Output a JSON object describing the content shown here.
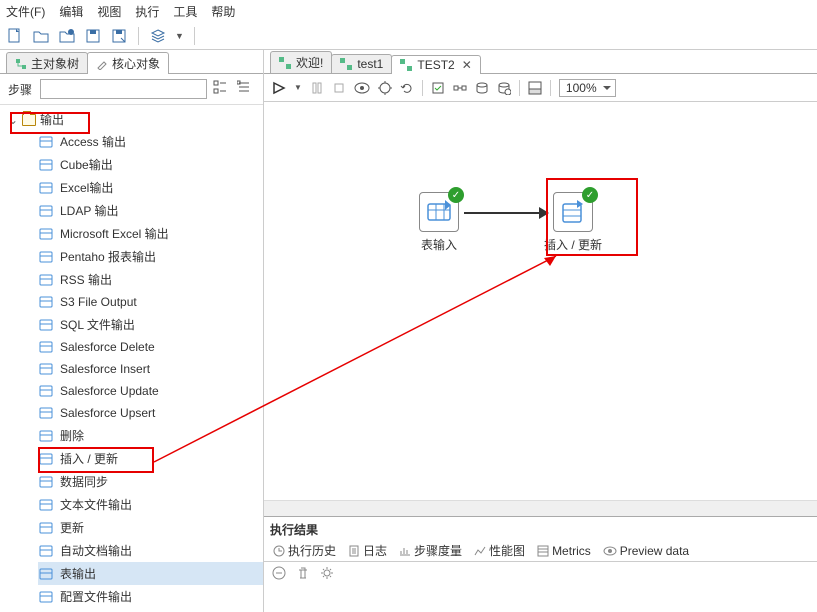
{
  "menu": {
    "file": "文件(F)",
    "edit": "编辑",
    "view": "视图",
    "run": "执行",
    "tools": "工具",
    "help": "帮助"
  },
  "leftTabs": {
    "main": "主对象树",
    "core": "核心对象"
  },
  "search": {
    "label": "步骤"
  },
  "tree": {
    "folder": "输出",
    "items": [
      "Access 输出",
      "Cube输出",
      "Excel输出",
      "LDAP 输出",
      "Microsoft Excel 输出",
      "Pentaho 报表输出",
      "RSS 输出",
      "S3 File Output",
      "SQL 文件输出",
      "Salesforce Delete",
      "Salesforce Insert",
      "Salesforce Update",
      "Salesforce Upsert",
      "删除",
      "插入 / 更新",
      "数据同步",
      "文本文件输出",
      "更新",
      "自动文档输出",
      "表输出",
      "配置文件输出"
    ],
    "selected": "表输出",
    "highlighted": "插入 / 更新"
  },
  "editorTabs": {
    "welcome": "欢迎!",
    "t1": "test1",
    "t2": "TEST2"
  },
  "zoom": "100%",
  "canvas": {
    "node1": "表输入",
    "node2": "插入 / 更新"
  },
  "results": {
    "title": "执行结果",
    "tabs": {
      "hist": "执行历史",
      "log": "日志",
      "metrics": "步骤度量",
      "perf": "性能图",
      "m": "Metrics",
      "prev": "Preview data"
    }
  }
}
